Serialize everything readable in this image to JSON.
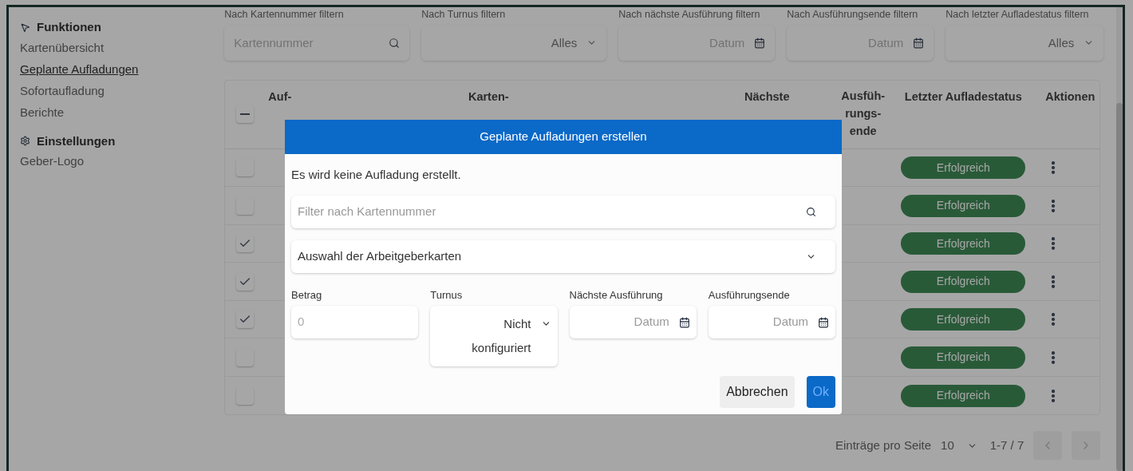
{
  "sidebar": {
    "sections": [
      {
        "title": "Funktionen",
        "items": [
          {
            "label": "Kartenübersicht",
            "selected": false
          },
          {
            "label": "Geplante Aufladungen",
            "selected": true
          },
          {
            "label": "Sofortaufladung",
            "selected": false
          },
          {
            "label": "Berichte",
            "selected": false
          }
        ]
      },
      {
        "title": "Einstellungen",
        "items": [
          {
            "label": "Geber-Logo",
            "selected": false
          }
        ]
      }
    ]
  },
  "filters": [
    {
      "label": "Nach Kartennummer filtern",
      "kind": "search",
      "placeholder": "Kartennummer"
    },
    {
      "label": "Nach Turnus filtern",
      "kind": "select",
      "value": "Alles"
    },
    {
      "label": "Nach nächste Ausführung filtern",
      "kind": "date",
      "placeholder": "Datum"
    },
    {
      "label": "Nach Ausführungsende filtern",
      "kind": "date",
      "placeholder": "Datum"
    },
    {
      "label": "Nach letzter Aufladestatus filtern",
      "kind": "select",
      "value": "Alles"
    }
  ],
  "table": {
    "select_all_partial": true,
    "header_texts": [
      "Auf-",
      "Karten-",
      "Nächste",
      "Ausfüh- rungs- ende",
      "Letzter Aufladestatus",
      "Aktionen"
    ],
    "rows": [
      {
        "checked": false,
        "status": "Erfolgreich"
      },
      {
        "checked": false,
        "status": "Erfolgreich"
      },
      {
        "checked": true,
        "status": "Erfolgreich"
      },
      {
        "checked": true,
        "status": "Erfolgreich"
      },
      {
        "checked": true,
        "status": "Erfolgreich"
      },
      {
        "checked": false,
        "status": "Erfolgreich"
      },
      {
        "checked": false,
        "status": "Erfolgreich"
      }
    ]
  },
  "pagination": {
    "label": "Einträge pro Seite",
    "page_size": "10",
    "range": "1-7 / 7"
  },
  "dialog": {
    "title": "Geplante Aufladungen erstellen",
    "message": "Es wird keine Aufladung erstellt.",
    "search": {
      "placeholder": "Filter nach Kartennummer"
    },
    "select": {
      "value": "Auswahl der Arbeitgeberkarten"
    },
    "fields": [
      {
        "label": "Betrag",
        "kind": "number",
        "placeholder": "0"
      },
      {
        "label": "Turnus",
        "kind": "select",
        "value": "Nicht konfiguriert"
      },
      {
        "label": "Nächste Ausführung",
        "kind": "date",
        "placeholder": "Datum"
      },
      {
        "label": "Ausführungsende",
        "kind": "date",
        "placeholder": "Datum"
      }
    ],
    "buttons": [
      {
        "label": "Abbrechen",
        "kind": "secondary"
      },
      {
        "label": "Ok",
        "kind": "primary"
      }
    ]
  }
}
